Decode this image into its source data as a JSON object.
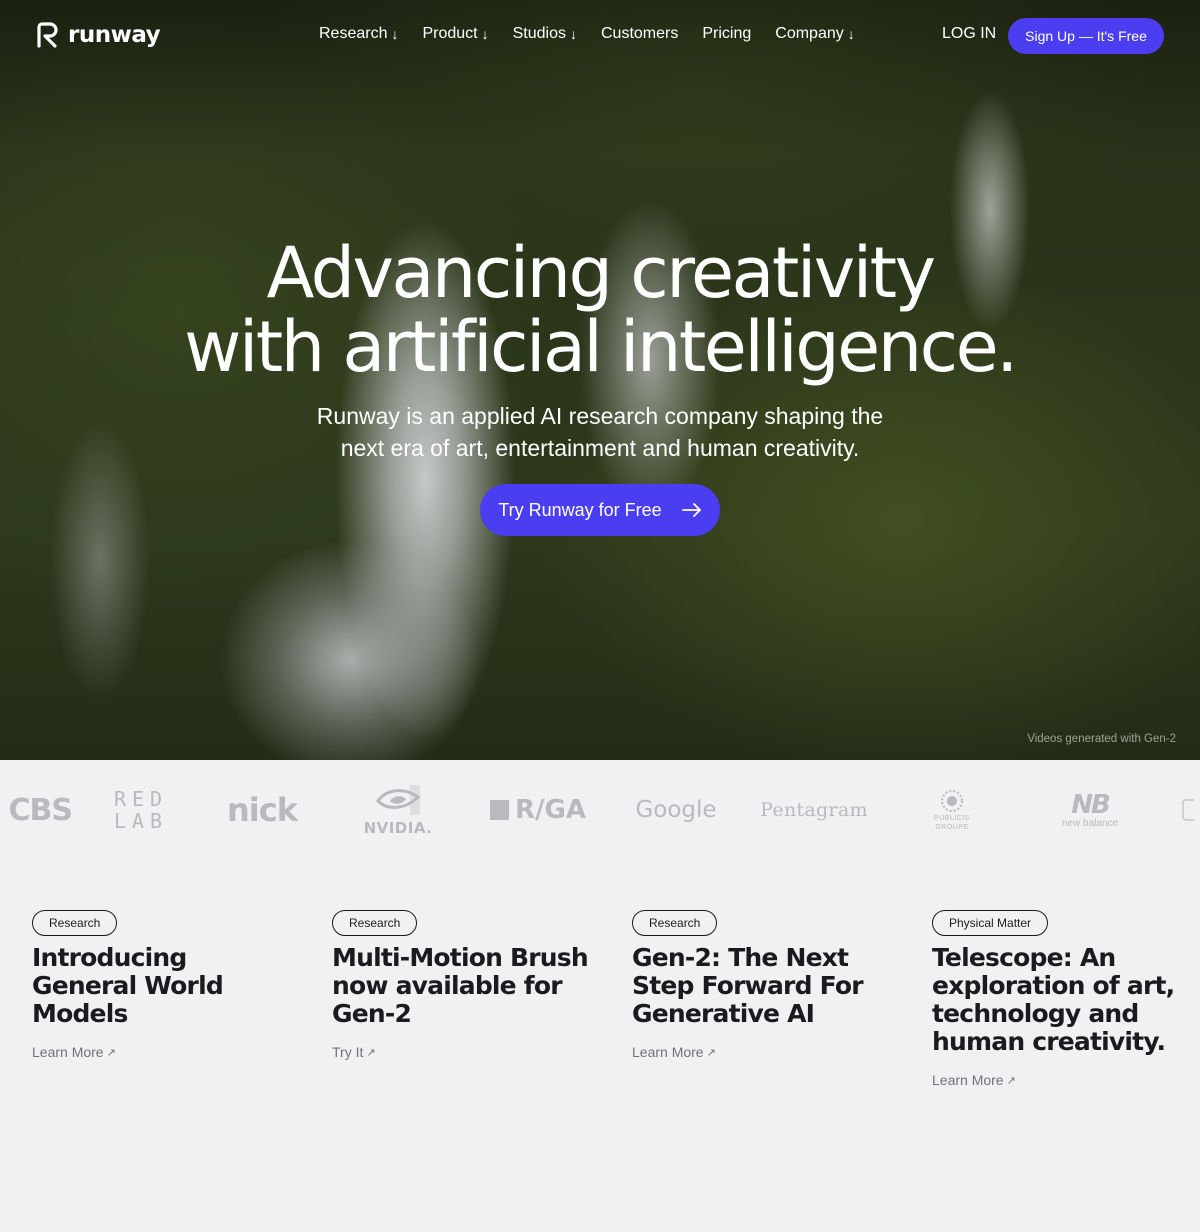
{
  "brand": {
    "name": "runway"
  },
  "nav": {
    "items": [
      {
        "label": "Research",
        "arrow": "↓"
      },
      {
        "label": "Product",
        "arrow": "↓"
      },
      {
        "label": "Studios",
        "arrow": "↓"
      },
      {
        "label": "Customers",
        "arrow": ""
      },
      {
        "label": "Pricing",
        "arrow": ""
      },
      {
        "label": "Company",
        "arrow": "↓"
      }
    ],
    "login_label": "LOG IN",
    "signup_label": "Sign Up — It's Free"
  },
  "hero": {
    "headline_line1": "Advancing creativity",
    "headline_line2": "with artificial intelligence.",
    "subtext_line1": "Runway is an applied AI research company shaping the",
    "subtext_line2": "next era of art, entertainment and human creativity.",
    "cta_label": "Try Runway for Free",
    "credit": "Videos generated with Gen-2"
  },
  "logos": {
    "cbs": "CBS",
    "redlab_line1": "RED",
    "redlab_line2": "LAB",
    "nick": "nick",
    "nvidia": "NVIDIA.",
    "rga": "R/GA",
    "google": "Google",
    "pentagram": "Pentagram",
    "publicis_line1": "PUBLICIS",
    "publicis_line2": "GROUPE",
    "newbalance_mark": "NB",
    "newbalance": "new balance"
  },
  "cards": [
    {
      "tag": "Research",
      "title": "Introducing General World Models",
      "link": "Learn More"
    },
    {
      "tag": "Research",
      "title": "Multi-Motion Brush now available for Gen-2",
      "link": "Try It"
    },
    {
      "tag": "Research",
      "title": "Gen-2: The Next Step Forward For Generative AI",
      "link": "Learn More"
    },
    {
      "tag": "Physical Matter",
      "title": "Telescope: An exploration of art, technology and human creativity.",
      "link": "Learn More"
    }
  ],
  "colors": {
    "accent": "#4a3ef0",
    "background": "#f1f1f3",
    "text": "#1b1b1f",
    "muted": "#70727a",
    "logo_gray": "#b9b9bf"
  }
}
